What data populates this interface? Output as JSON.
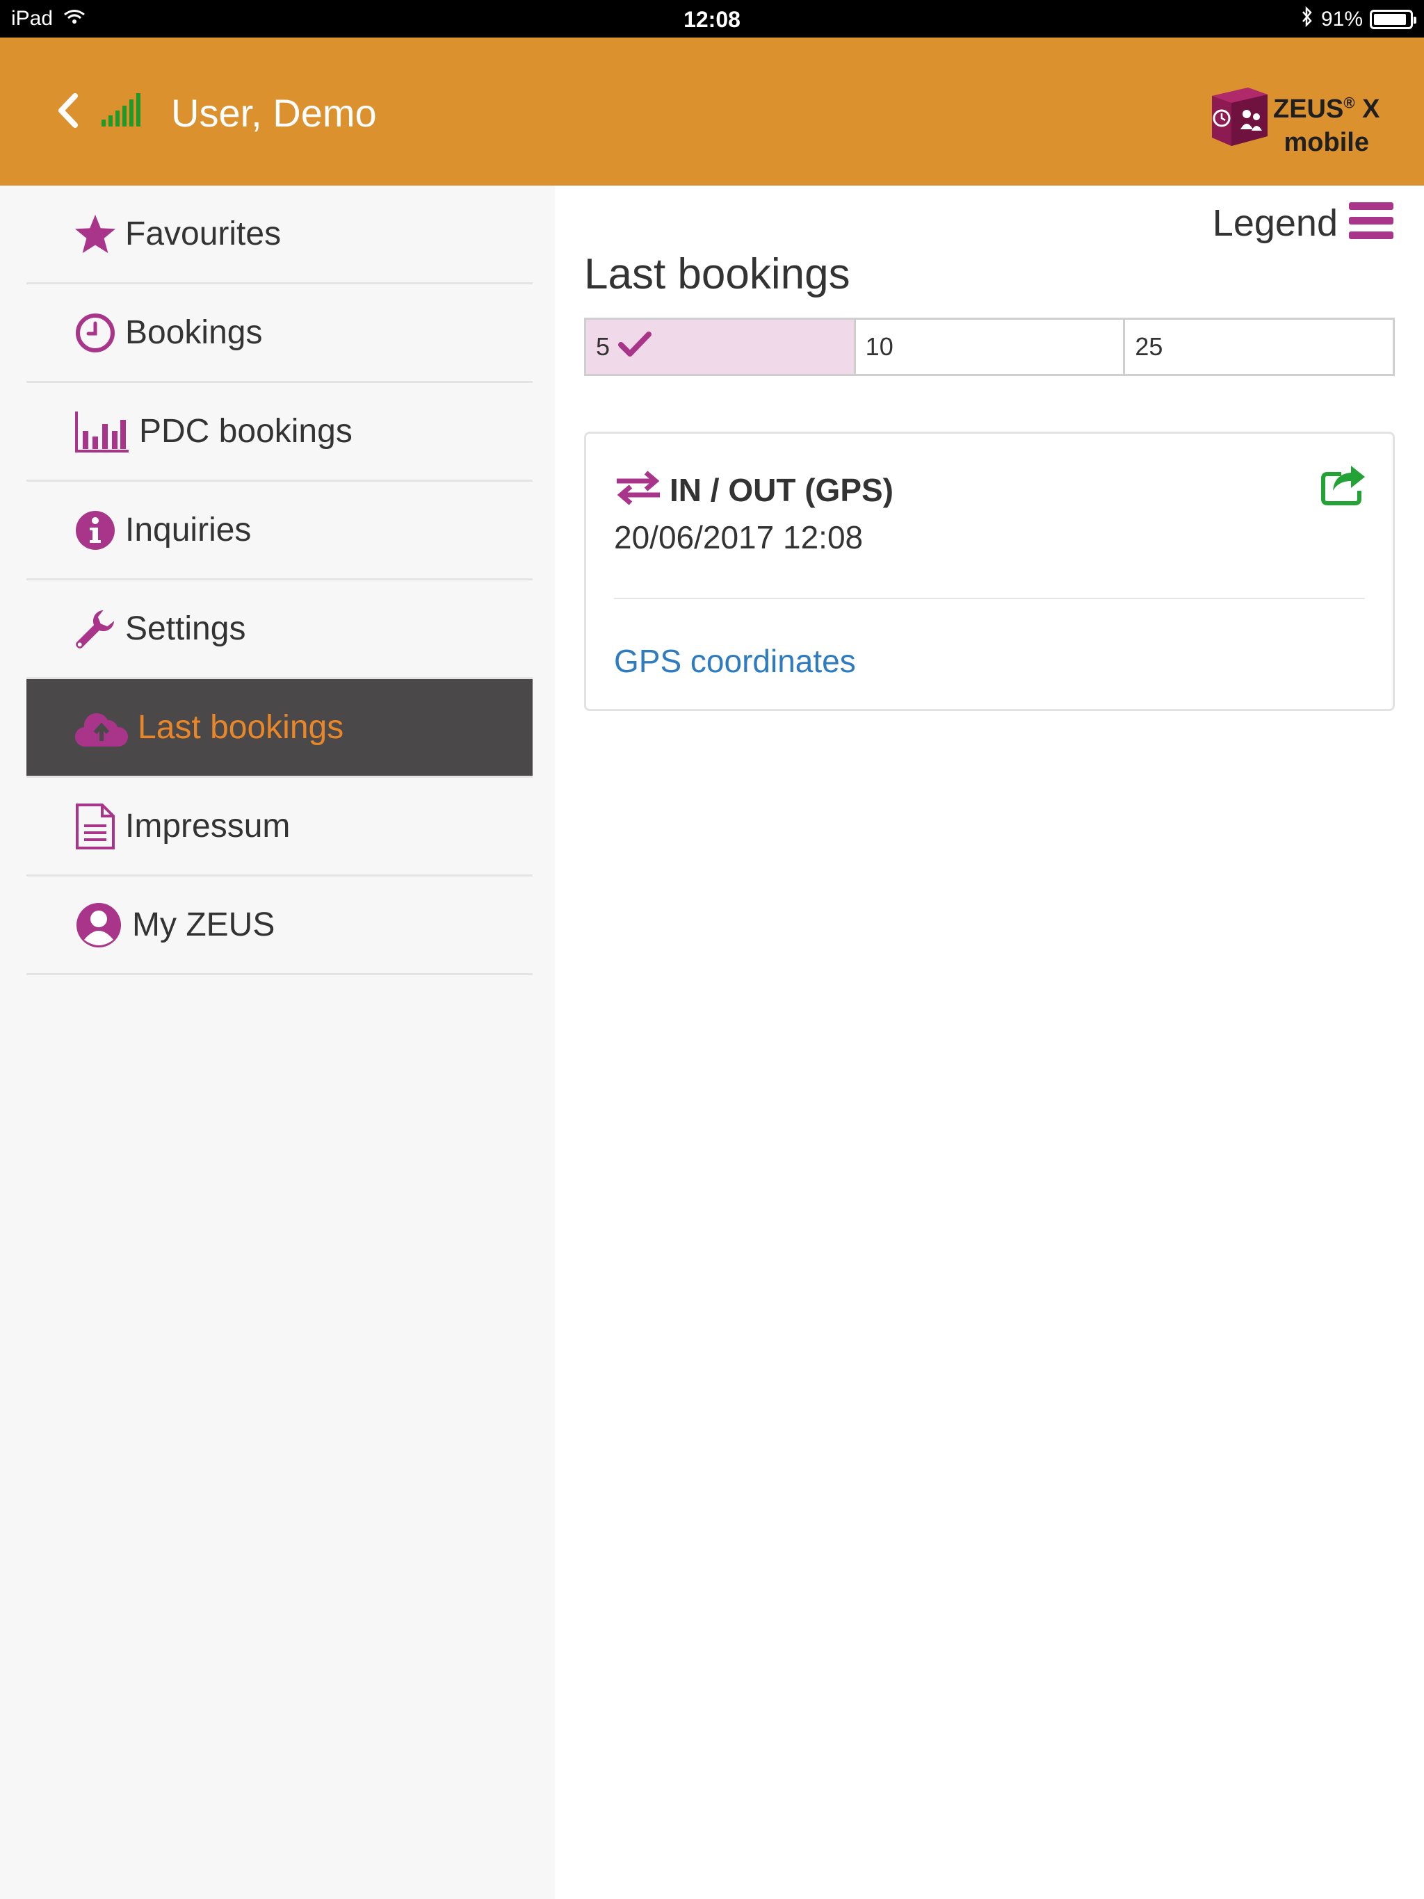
{
  "status_bar": {
    "device": "iPad",
    "time": "12:08",
    "battery": "91%",
    "battery_level": 0.91,
    "wifi_icon": "wifi-icon",
    "bluetooth_icon": "bluetooth-icon"
  },
  "header": {
    "user_name": "User, Demo",
    "logo": {
      "brand": "ZEUS",
      "registered": "®",
      "suffix": " X",
      "line2": "mobile"
    }
  },
  "sidebar": {
    "items": [
      {
        "label": "Favourites",
        "icon": "star-icon"
      },
      {
        "label": "Bookings",
        "icon": "clock-icon"
      },
      {
        "label": "PDC bookings",
        "icon": "bar-chart-icon"
      },
      {
        "label": "Inquiries",
        "icon": "info-icon"
      },
      {
        "label": "Settings",
        "icon": "wrench-icon"
      },
      {
        "label": "Last bookings",
        "icon": "cloud-upload-icon",
        "active": true
      },
      {
        "label": "Impressum",
        "icon": "document-icon"
      },
      {
        "label": "My ZEUS",
        "icon": "user-icon"
      }
    ]
  },
  "main": {
    "legend_label": "Legend",
    "title": "Last bookings",
    "segments": [
      {
        "label": "5",
        "selected": true
      },
      {
        "label": "10",
        "selected": false
      },
      {
        "label": "25",
        "selected": false
      }
    ],
    "booking": {
      "type": "IN / OUT (GPS)",
      "datetime": "20/06/2017 12:08",
      "link": "GPS coordinates"
    }
  },
  "colors": {
    "header": "#dc912f",
    "accent": "#a8358a",
    "active_bg": "#4a4849",
    "active_text": "#e8862a",
    "link": "#2f7bbf",
    "share": "#23a335",
    "signal": "#1f9a2a"
  }
}
